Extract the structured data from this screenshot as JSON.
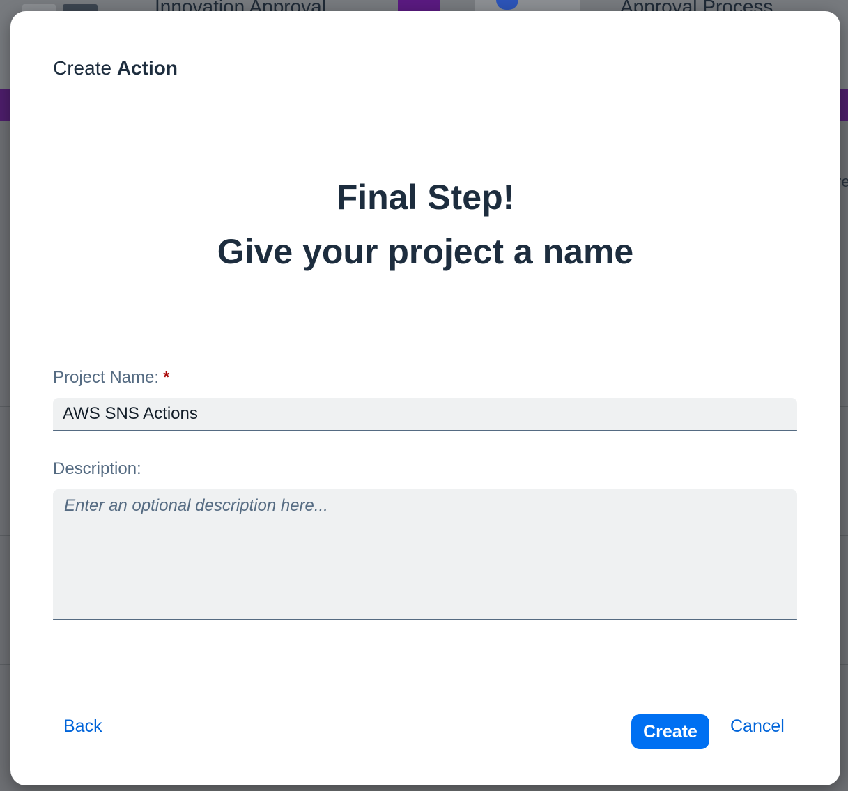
{
  "background": {
    "header_title_left": "Innovation Approval",
    "header_title_right": "Approval Process",
    "edge_text": "re"
  },
  "dialog": {
    "title_prefix": "Create",
    "title_bold": "Action",
    "heading_line1": "Final Step!",
    "heading_line2": "Give your project a name"
  },
  "form": {
    "project_name": {
      "label": "Project Name:",
      "required_marker": "*",
      "value": "AWS SNS Actions"
    },
    "description": {
      "label": "Description:",
      "placeholder": "Enter an optional description here...",
      "value": ""
    }
  },
  "footer": {
    "back_label": "Back",
    "create_label": "Create",
    "cancel_label": "Cancel"
  },
  "colors": {
    "primary": "#0070f2",
    "link": "#0064d9",
    "text": "#1d2d3e",
    "required": "#aa0808"
  }
}
